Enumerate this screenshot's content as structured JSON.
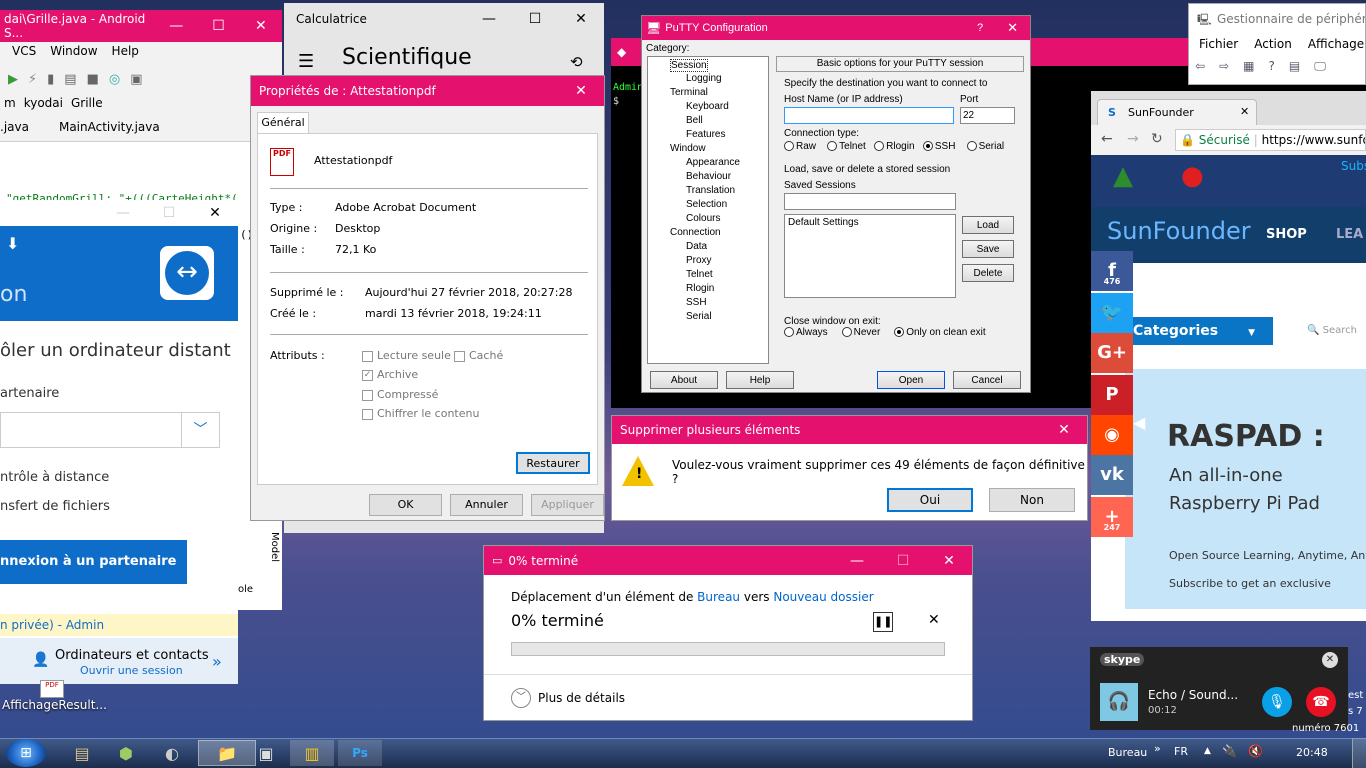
{
  "android_studio": {
    "title": "dai\\Grille.java - Android S...",
    "menu": [
      "VCS",
      "Window",
      "Help"
    ],
    "breadcrumb": [
      "m",
      "kyodai",
      "Grille"
    ],
    "tabs": [
      ".java",
      "MainActivity.java"
    ],
    "code_line": "\"getRandomGrill: \"+(((CarteHeight*(",
    "code_line2": "()",
    "side_label": "Model",
    "bottom1": "ole"
  },
  "calculator": {
    "title": "Calculatrice",
    "mode": "Scientifique"
  },
  "props": {
    "title": "Propriétés de : Attestationpdf",
    "tab": "Général",
    "filename": "Attestationpdf",
    "type_label": "Type :",
    "type_value": "Adobe Acrobat Document",
    "origin_label": "Origine :",
    "origin_value": "Desktop",
    "size_label": "Taille :",
    "size_value": "72,1 Ko",
    "deleted_label": "Supprimé le :",
    "deleted_value": "Aujourd'hui 27 février 2018, 20:27:28",
    "created_label": "Créé le :",
    "created_value": "mardi 13 février 2018, 19:24:11",
    "attr_label": "Attributs :",
    "attr_readonly": "Lecture seule",
    "attr_hidden": "Caché",
    "attr_archive": "Archive",
    "attr_compressed": "Compressé",
    "attr_encrypt": "Chiffrer le contenu",
    "restore": "Restaurer",
    "ok": "OK",
    "cancel": "Annuler",
    "apply": "Appliquer"
  },
  "teamviewer": {
    "partial1": "on",
    "heading": "ôler un ordinateur distant",
    "partner": "artenaire",
    "opt1": "ntrôle à distance",
    "opt2": "nsfert de fichiers",
    "connect": "nnexion à un partenaire",
    "status": "n privée) - Admin",
    "contacts": "Ordinateurs et contacts",
    "contacts_link": "Ouvrir une session"
  },
  "putty": {
    "title": "PuTTY Configuration",
    "category": "Category:",
    "tree": [
      "Session",
      "Logging",
      "Terminal",
      "Keyboard",
      "Bell",
      "Features",
      "Window",
      "Appearance",
      "Behaviour",
      "Translation",
      "Selection",
      "Colours",
      "Connection",
      "Data",
      "Proxy",
      "Telnet",
      "Rlogin",
      "SSH",
      "Serial"
    ],
    "header": "Basic options for your PuTTY session",
    "dest": "Specify the destination you want to connect to",
    "host_label": "Host Name (or IP address)",
    "port_label": "Port",
    "port": "22",
    "conn_type": "Connection type:",
    "types": [
      "Raw",
      "Telnet",
      "Rlogin",
      "SSH",
      "Serial"
    ],
    "load_save": "Load, save or delete a stored session",
    "saved": "Saved Sessions",
    "default": "Default Settings",
    "load": "Load",
    "save": "Save",
    "delete": "Delete",
    "close_exit": "Close window on exit:",
    "exit_opts": [
      "Always",
      "Never",
      "Only on clean exit"
    ],
    "about": "About",
    "help": "Help",
    "open": "Open",
    "cancel": "Cancel"
  },
  "terminal": {
    "prompt": "Admin",
    "prompt2": "$"
  },
  "delete_dialog": {
    "title": "Supprimer plusieurs éléments",
    "message": "Voulez-vous vraiment supprimer ces 49 éléments de façon définitive ?",
    "yes": "Oui",
    "no": "Non"
  },
  "progress": {
    "title": "0% terminé",
    "line_pre": "Déplacement d'un élément de ",
    "from": "Bureau",
    "mid": " vers ",
    "to": "Nouveau dossier",
    "percent": "0% terminé",
    "value": 0,
    "details": "Plus de détails"
  },
  "devmgr": {
    "title": "Gestionnaire de périphérique",
    "menu": [
      "Fichier",
      "Action",
      "Affichage"
    ]
  },
  "browser": {
    "tab": "SunFounder",
    "secure": "Sécurisé",
    "url": "https://www.sunfound",
    "brand": "SunFounder",
    "shop": "SHOP",
    "lea": "LEA",
    "categories": "Categories",
    "search": "Search",
    "subs": "Subs",
    "ad_title": "RASPAD :",
    "ad_line1": "An all-in-one",
    "ad_line2": "Raspberry Pi Pad",
    "ad_line3": "Open Source Learning, Anytime, Any",
    "ad_line4": "Subscribe to get an exclusive",
    "share_f": "476",
    "share_plus": "247"
  },
  "skype": {
    "brand": "skype",
    "name": "Echo / Sound...",
    "time": "00:12"
  },
  "desktop": {
    "icon_label": "AffichageResult...",
    "side_text1": "est",
    "side_text2": "s 7",
    "side_text3": "numéro 7601"
  },
  "taskbar": {
    "bureau": "Bureau",
    "lang": "FR",
    "time": "20:48"
  }
}
